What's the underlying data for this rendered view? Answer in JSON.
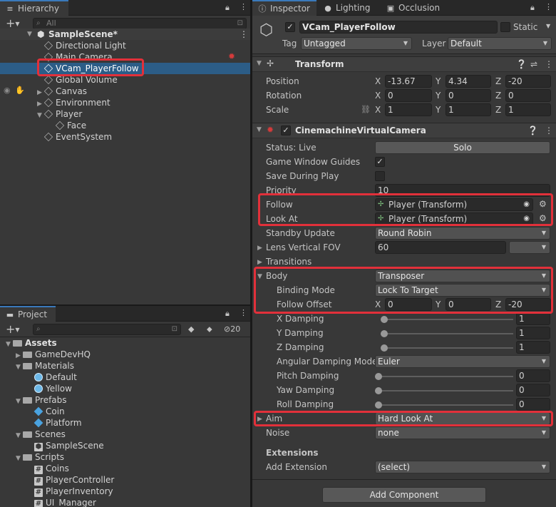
{
  "hierarchy": {
    "tab_label": "Hierarchy",
    "search_placeholder": "All",
    "scene_name": "SampleScene*",
    "items": [
      {
        "label": "Directional Light"
      },
      {
        "label": "Main Camera"
      },
      {
        "label": "VCam_PlayerFollow"
      },
      {
        "label": "Global Volume"
      },
      {
        "label": "Canvas"
      },
      {
        "label": "Environment"
      },
      {
        "label": "Player"
      },
      {
        "label": "Face"
      },
      {
        "label": "EventSystem"
      }
    ]
  },
  "project": {
    "tab_label": "Project",
    "hidden_count": "20",
    "root": "Assets",
    "items": [
      {
        "label": "GameDevHQ"
      },
      {
        "label": "Materials"
      },
      {
        "label": "Default"
      },
      {
        "label": "Yellow"
      },
      {
        "label": "Prefabs"
      },
      {
        "label": "Coin"
      },
      {
        "label": "Platform"
      },
      {
        "label": "Scenes"
      },
      {
        "label": "SampleScene"
      },
      {
        "label": "Scripts"
      },
      {
        "label": "Coins"
      },
      {
        "label": "PlayerController"
      },
      {
        "label": "PlayerInventory"
      },
      {
        "label": "UI_Manager"
      }
    ]
  },
  "inspector": {
    "tabs": [
      {
        "label": "Inspector"
      },
      {
        "label": "Lighting"
      },
      {
        "label": "Occlusion"
      }
    ],
    "object_name": "VCam_PlayerFollow",
    "static_label": "Static",
    "tag_label": "Tag",
    "tag_value": "Untagged",
    "layer_label": "Layer",
    "layer_value": "Default",
    "transform": {
      "title": "Transform",
      "position_label": "Position",
      "rotation_label": "Rotation",
      "scale_label": "Scale",
      "axis_x": "X",
      "axis_y": "Y",
      "axis_z": "Z",
      "position": [
        "-13.67",
        "4.34",
        "-20"
      ],
      "rotation": [
        "0",
        "0",
        "0"
      ],
      "scale": [
        "1",
        "1",
        "1"
      ]
    },
    "vcam": {
      "title": "CinemachineVirtualCamera",
      "status_label": "Status: Live",
      "solo_label": "Solo",
      "game_window_guides_label": "Game Window Guides",
      "save_during_play_label": "Save During Play",
      "priority_label": "Priority",
      "priority_value": "10",
      "follow_label": "Follow",
      "follow_value": "Player (Transform)",
      "look_at_label": "Look At",
      "look_at_value": "Player (Transform)",
      "standby_label": "Standby Update",
      "standby_value": "Round Robin",
      "lens_label": "Lens Vertical FOV",
      "lens_value": "60",
      "transitions_label": "Transitions",
      "body_label": "Body",
      "body_value": "Transposer",
      "binding_label": "Binding Mode",
      "binding_value": "Lock To Target",
      "follow_offset_label": "Follow Offset",
      "follow_offset": [
        "0",
        "0",
        "-20"
      ],
      "damping": [
        {
          "label": "X Damping",
          "value": "1",
          "fraction": 0.0
        },
        {
          "label": "Y Damping",
          "value": "1",
          "fraction": 0.0
        },
        {
          "label": "Z Damping",
          "value": "1",
          "fraction": 0.0
        },
        {
          "label": "Angular Damping Mode",
          "value": "Euler"
        },
        {
          "label": "Pitch Damping",
          "value": "0",
          "fraction": 0.0
        },
        {
          "label": "Yaw Damping",
          "value": "0",
          "fraction": 0.0
        },
        {
          "label": "Roll Damping",
          "value": "0",
          "fraction": 0.0
        }
      ],
      "aim_label": "Aim",
      "aim_value": "Hard Look At",
      "noise_label": "Noise",
      "noise_value": "none",
      "extensions_label": "Extensions",
      "add_extension_label": "Add Extension",
      "add_extension_value": "(select)"
    },
    "add_component_label": "Add Component"
  },
  "colors": {
    "highlight_box": "#e2303a",
    "selection": "#2c5d87"
  }
}
